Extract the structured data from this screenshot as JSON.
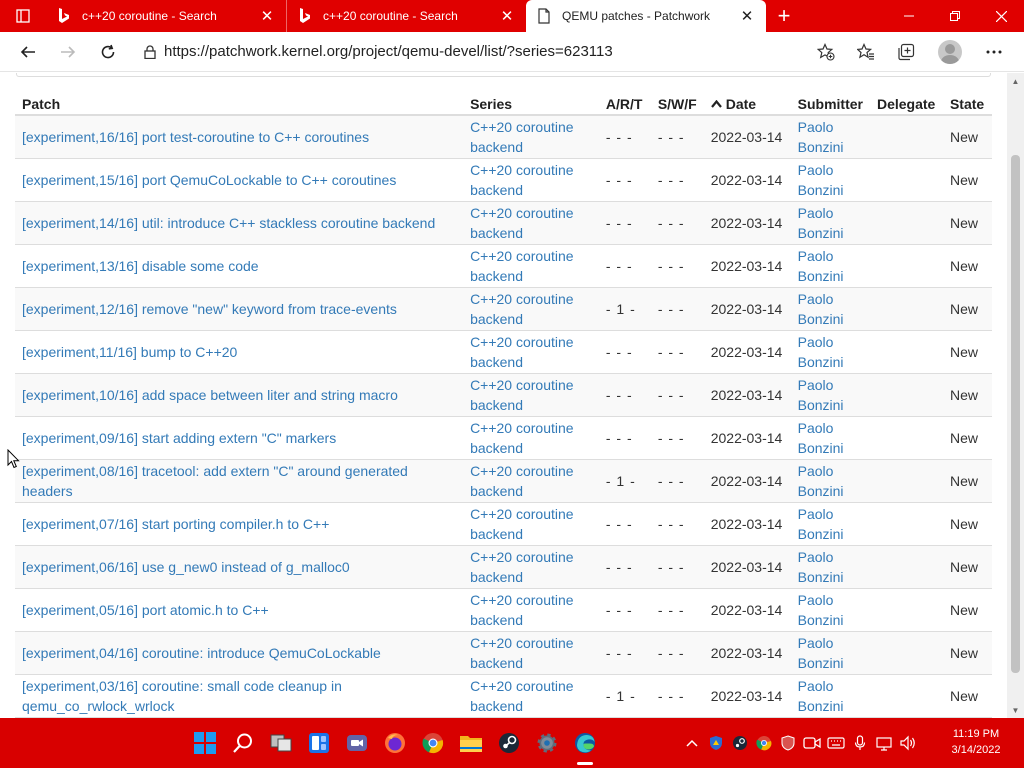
{
  "browser": {
    "tabs": [
      {
        "title": "c++20 coroutine - Search",
        "state": "inactive",
        "favicon": "bing-icon"
      },
      {
        "title": "c++20 coroutine - Search",
        "state": "inactive",
        "favicon": "bing-icon"
      },
      {
        "title": "QEMU patches - Patchwork",
        "state": "active",
        "favicon": "document-icon"
      }
    ],
    "newtab": "+",
    "url": "https://patchwork.kernel.org/project/qemu-devel/list/?series=623113"
  },
  "table": {
    "headers": {
      "patch": "Patch",
      "series": "Series",
      "art": "A/R/T",
      "swf": "S/W/F",
      "date": "Date",
      "submitter": "Submitter",
      "delegate": "Delegate",
      "state": "State"
    },
    "rows": [
      {
        "patch": "[experiment,16/16] port test-coroutine to C++ coroutines",
        "series": "C++20 coroutine backend",
        "art": "- - -",
        "swf": "-  -  -",
        "date": "2022-03-14",
        "submitter": "Paolo Bonzini",
        "delegate": "",
        "state": "New"
      },
      {
        "patch": "[experiment,15/16] port QemuCoLockable to C++ coroutines",
        "series": "C++20 coroutine backend",
        "art": "- - -",
        "swf": "-  -  -",
        "date": "2022-03-14",
        "submitter": "Paolo Bonzini",
        "delegate": "",
        "state": "New"
      },
      {
        "patch": "[experiment,14/16] util: introduce C++ stackless coroutine backend",
        "series": "C++20 coroutine backend",
        "art": "- - -",
        "swf": "-  -  -",
        "date": "2022-03-14",
        "submitter": "Paolo Bonzini",
        "delegate": "",
        "state": "New"
      },
      {
        "patch": "[experiment,13/16] disable some code",
        "series": "C++20 coroutine backend",
        "art": "- - -",
        "swf": "-  -  -",
        "date": "2022-03-14",
        "submitter": "Paolo Bonzini",
        "delegate": "",
        "state": "New"
      },
      {
        "patch": "[experiment,12/16] remove \"new\" keyword from trace-events",
        "series": "C++20 coroutine backend",
        "art": "- 1 -",
        "swf": "-  -  -",
        "date": "2022-03-14",
        "submitter": "Paolo Bonzini",
        "delegate": "",
        "state": "New"
      },
      {
        "patch": "[experiment,11/16] bump to C++20",
        "series": "C++20 coroutine backend",
        "art": "- - -",
        "swf": "-  -  -",
        "date": "2022-03-14",
        "submitter": "Paolo Bonzini",
        "delegate": "",
        "state": "New"
      },
      {
        "patch": "[experiment,10/16] add space between liter and string macro",
        "series": "C++20 coroutine backend",
        "art": "- - -",
        "swf": "-  -  -",
        "date": "2022-03-14",
        "submitter": "Paolo Bonzini",
        "delegate": "",
        "state": "New"
      },
      {
        "patch": "[experiment,09/16] start adding extern \"C\" markers",
        "series": "C++20 coroutine backend",
        "art": "- - -",
        "swf": "-  -  -",
        "date": "2022-03-14",
        "submitter": "Paolo Bonzini",
        "delegate": "",
        "state": "New"
      },
      {
        "patch": "[experiment,08/16] tracetool: add extern \"C\" around generated headers",
        "series": "C++20 coroutine backend",
        "art": "- 1 -",
        "swf": "-  -  -",
        "date": "2022-03-14",
        "submitter": "Paolo Bonzini",
        "delegate": "",
        "state": "New"
      },
      {
        "patch": "[experiment,07/16] start porting compiler.h to C++",
        "series": "C++20 coroutine backend",
        "art": "- - -",
        "swf": "-  -  -",
        "date": "2022-03-14",
        "submitter": "Paolo Bonzini",
        "delegate": "",
        "state": "New"
      },
      {
        "patch": "[experiment,06/16] use g_new0 instead of g_malloc0",
        "series": "C++20 coroutine backend",
        "art": "- - -",
        "swf": "-  -  -",
        "date": "2022-03-14",
        "submitter": "Paolo Bonzini",
        "delegate": "",
        "state": "New"
      },
      {
        "patch": "[experiment,05/16] port atomic.h to C++",
        "series": "C++20 coroutine backend",
        "art": "- - -",
        "swf": "-  -  -",
        "date": "2022-03-14",
        "submitter": "Paolo Bonzini",
        "delegate": "",
        "state": "New"
      },
      {
        "patch": "[experiment,04/16] coroutine: introduce QemuCoLockable",
        "series": "C++20 coroutine backend",
        "art": "- - -",
        "swf": "-  -  -",
        "date": "2022-03-14",
        "submitter": "Paolo Bonzini",
        "delegate": "",
        "state": "New"
      },
      {
        "patch": "[experiment,03/16] coroutine: small code cleanup in qemu_co_rwlock_wrlock",
        "series": "C++20 coroutine backend",
        "art": "- 1 -",
        "swf": "-  -  -",
        "date": "2022-03-14",
        "submitter": "Paolo Bonzini",
        "delegate": "",
        "state": "New"
      }
    ]
  },
  "taskbar": {
    "apps": [
      "windows-start-icon",
      "search-icon",
      "task-view-icon",
      "widgets-icon",
      "teams-chat-icon",
      "firefox-icon",
      "chrome-icon",
      "file-explorer-icon",
      "steam-icon",
      "settings-icon",
      "edge-icon"
    ],
    "active_app": "edge-icon",
    "time": "11:19 PM",
    "date": "3/14/2022"
  },
  "colors": {
    "accent_red": "#e00000",
    "link_blue": "#337ab7",
    "taskbar_red": "#d80000"
  }
}
